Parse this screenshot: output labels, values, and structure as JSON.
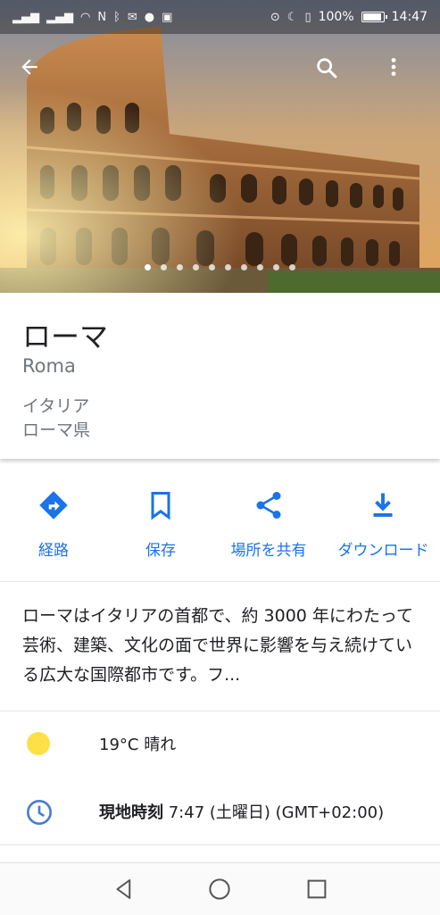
{
  "status": {
    "battery": "100%",
    "time": "14:47"
  },
  "hero": {
    "photo_count": 10,
    "active_index": 0
  },
  "place": {
    "title": "ローマ",
    "subtitle": "Roma",
    "address_line1": "イタリア",
    "address_line2": "ローマ県"
  },
  "actions": {
    "directions": "経路",
    "save": "保存",
    "share": "場所を共有",
    "download": "ダウンロード"
  },
  "description": "ローマはイタリアの首都で、約 3000 年にわたって芸術、建築、文化の面で世界に影響を与え続けている広大な国際都市です。フ...",
  "weather": {
    "text": "19°C 晴れ"
  },
  "local_time": {
    "label": "現地時刻",
    "value": "7:47 (土曜日) (GMT+02:00)"
  },
  "colors": {
    "accent": "#1a73e8",
    "sun": "#fde047",
    "text": "#202124",
    "secondary": "#70757a"
  }
}
